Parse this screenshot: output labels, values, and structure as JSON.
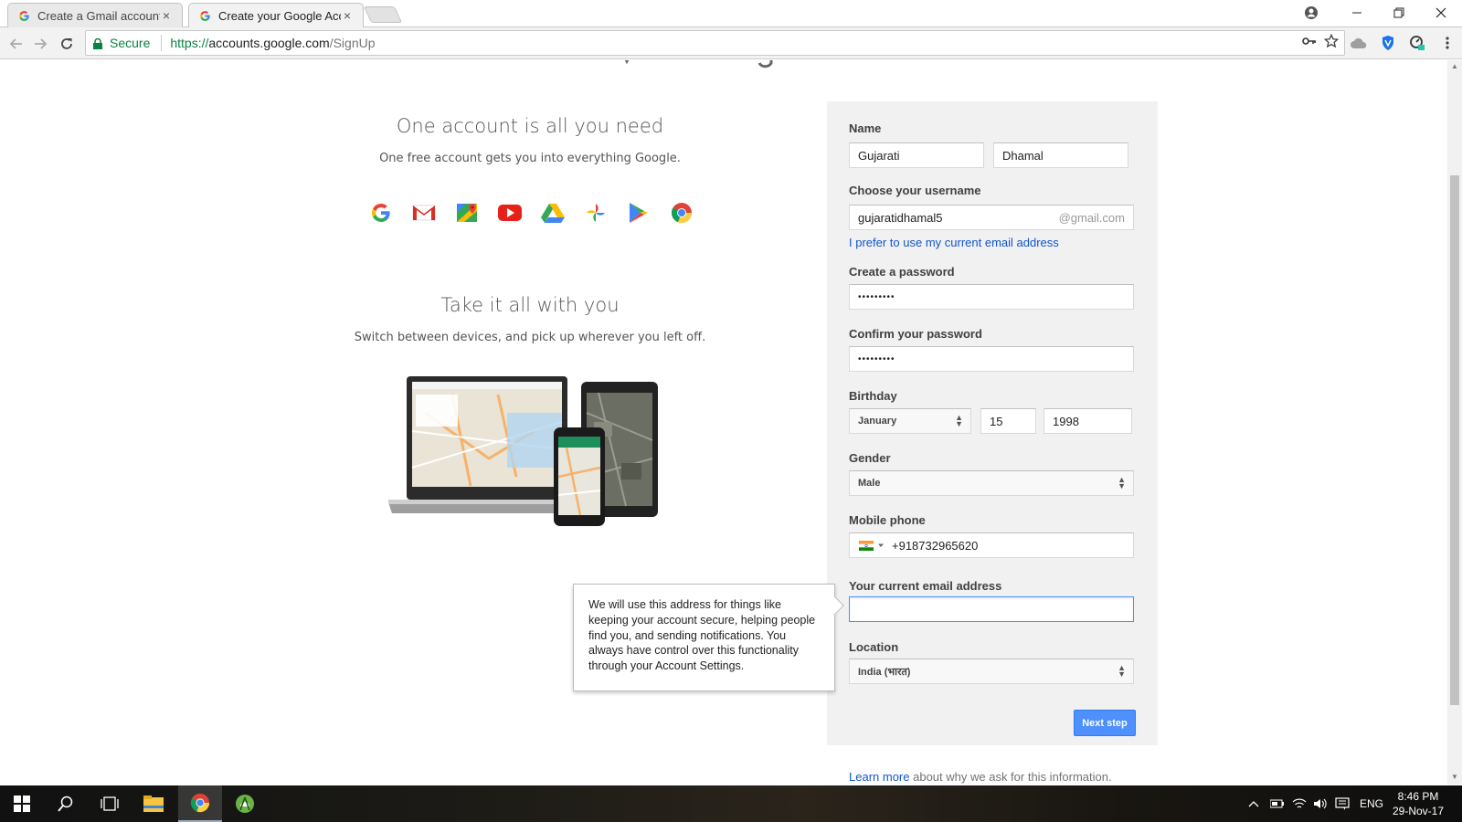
{
  "browser": {
    "tabs": [
      {
        "title": "Create a Gmail account -",
        "close": "×",
        "active": false
      },
      {
        "title": "Create your Google Acc",
        "close": "×",
        "active": true
      }
    ],
    "secure_label": "Secure",
    "url_proto": "https://",
    "url_host": "accounts.google.com",
    "url_path": "/SignUp"
  },
  "promo": {
    "block1_title": "One account is all you need",
    "block1_sub": "One free account gets you into everything Google.",
    "block2_title": "Take it all with you",
    "block2_sub": "Switch between devices, and pick up wherever you left off.",
    "app_icons": [
      "google-icon",
      "gmail-icon",
      "maps-icon",
      "youtube-icon",
      "drive-icon",
      "photos-icon",
      "play-icon",
      "chrome-icon"
    ]
  },
  "form": {
    "name_label": "Name",
    "first_name": "Gujarati",
    "last_name": "Dhamal",
    "username_label": "Choose your username",
    "username": "gujaratidhamal5",
    "username_suffix": "@gmail.com",
    "prefer_link": "I prefer to use my current email address",
    "password_label": "Create a password",
    "password_value": "•••••••••",
    "confirm_label": "Confirm your password",
    "confirm_value": "•••••••••",
    "birthday_label": "Birthday",
    "birth_month": "January",
    "birth_day": "15",
    "birth_year": "1998",
    "gender_label": "Gender",
    "gender": "Male",
    "phone_label": "Mobile phone",
    "phone": "+918732965620",
    "email_label": "Your current email address",
    "email_value": "",
    "location_label": "Location",
    "location": "India (भारत)",
    "next_button": "Next step",
    "learn_link": "Learn more",
    "learn_rest": "about why we ask for this information."
  },
  "tooltip": {
    "text": "We will use this address for things like keeping your account secure, helping people find you, and sending notifications. You always have control over this functionality through your Account Settings."
  },
  "taskbar": {
    "lang": "ENG",
    "time": "8:46 PM",
    "date": "29-Nov-17"
  },
  "colors": {
    "primary_button": "#4d90fe",
    "link": "#1155cc",
    "secure_green": "#0b8043",
    "form_bg": "#f1f1f1"
  }
}
